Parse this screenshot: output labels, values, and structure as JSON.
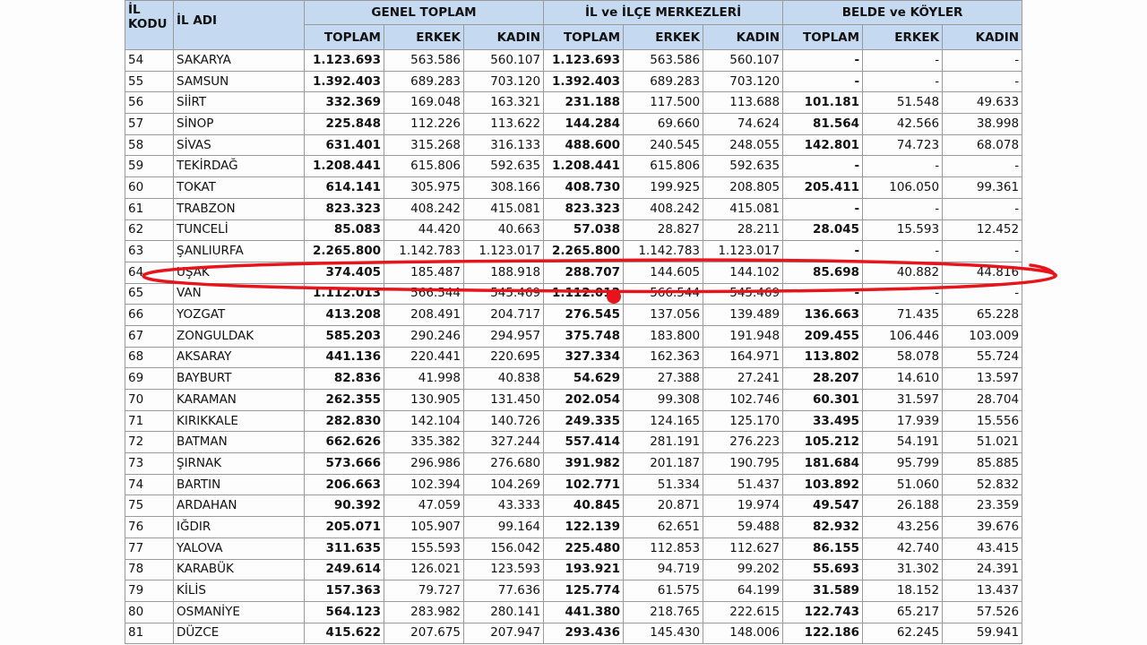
{
  "header": {
    "il_kodu": "İL KODU",
    "il_adi": "İL ADI",
    "groups": [
      "GENEL TOPLAM",
      "İL ve İLÇE MERKEZLERİ",
      "BELDE ve KÖYLER"
    ],
    "subcols": [
      "TOPLAM",
      "ERKEK",
      "KADIN",
      "TOPLAM",
      "ERKEK",
      "KADIN",
      "TOPLAM",
      "ERKEK",
      "KADIN"
    ]
  },
  "rows": [
    [
      "54",
      "SAKARYA",
      "1.123.693",
      "563.586",
      "560.107",
      "1.123.693",
      "563.586",
      "560.107",
      "-",
      "-",
      "-"
    ],
    [
      "55",
      "SAMSUN",
      "1.392.403",
      "689.283",
      "703.120",
      "1.392.403",
      "689.283",
      "703.120",
      "-",
      "-",
      "-"
    ],
    [
      "56",
      "SİİRT",
      "332.369",
      "169.048",
      "163.321",
      "231.188",
      "117.500",
      "113.688",
      "101.181",
      "51.548",
      "49.633"
    ],
    [
      "57",
      "SİNOP",
      "225.848",
      "112.226",
      "113.622",
      "144.284",
      "69.660",
      "74.624",
      "81.564",
      "42.566",
      "38.998"
    ],
    [
      "58",
      "SİVAS",
      "631.401",
      "315.268",
      "316.133",
      "488.600",
      "240.545",
      "248.055",
      "142.801",
      "74.723",
      "68.078"
    ],
    [
      "59",
      "TEKİRDAĞ",
      "1.208.441",
      "615.806",
      "592.635",
      "1.208.441",
      "615.806",
      "592.635",
      "-",
      "-",
      "-"
    ],
    [
      "60",
      "TOKAT",
      "614.141",
      "305.975",
      "308.166",
      "408.730",
      "199.925",
      "208.805",
      "205.411",
      "106.050",
      "99.361"
    ],
    [
      "61",
      "TRABZON",
      "823.323",
      "408.242",
      "415.081",
      "823.323",
      "408.242",
      "415.081",
      "-",
      "-",
      "-"
    ],
    [
      "62",
      "TUNCELİ",
      "85.083",
      "44.420",
      "40.663",
      "57.038",
      "28.827",
      "28.211",
      "28.045",
      "15.593",
      "12.452"
    ],
    [
      "63",
      "ŞANLIURFA",
      "2.265.800",
      "1.142.783",
      "1.123.017",
      "2.265.800",
      "1.142.783",
      "1.123.017",
      "-",
      "-",
      "-"
    ],
    [
      "64",
      "UŞAK",
      "374.405",
      "185.487",
      "188.918",
      "288.707",
      "144.605",
      "144.102",
      "85.698",
      "40.882",
      "44.816"
    ],
    [
      "65",
      "VAN",
      "1.112.013",
      "566.544",
      "545.469",
      "1.112.013",
      "566.544",
      "545.469",
      "-",
      "-",
      "-"
    ],
    [
      "66",
      "YOZGAT",
      "413.208",
      "208.491",
      "204.717",
      "276.545",
      "137.056",
      "139.489",
      "136.663",
      "71.435",
      "65.228"
    ],
    [
      "67",
      "ZONGULDAK",
      "585.203",
      "290.246",
      "294.957",
      "375.748",
      "183.800",
      "191.948",
      "209.455",
      "106.446",
      "103.009"
    ],
    [
      "68",
      "AKSARAY",
      "441.136",
      "220.441",
      "220.695",
      "327.334",
      "162.363",
      "164.971",
      "113.802",
      "58.078",
      "55.724"
    ],
    [
      "69",
      "BAYBURT",
      "82.836",
      "41.998",
      "40.838",
      "54.629",
      "27.388",
      "27.241",
      "28.207",
      "14.610",
      "13.597"
    ],
    [
      "70",
      "KARAMAN",
      "262.355",
      "130.905",
      "131.450",
      "202.054",
      "99.308",
      "102.746",
      "60.301",
      "31.597",
      "28.704"
    ],
    [
      "71",
      "KIRIKKALE",
      "282.830",
      "142.104",
      "140.726",
      "249.335",
      "124.165",
      "125.170",
      "33.495",
      "17.939",
      "15.556"
    ],
    [
      "72",
      "BATMAN",
      "662.626",
      "335.382",
      "327.244",
      "557.414",
      "281.191",
      "276.223",
      "105.212",
      "54.191",
      "51.021"
    ],
    [
      "73",
      "ŞIRNAK",
      "573.666",
      "296.986",
      "276.680",
      "391.982",
      "201.187",
      "190.795",
      "181.684",
      "95.799",
      "85.885"
    ],
    [
      "74",
      "BARTIN",
      "206.663",
      "102.394",
      "104.269",
      "102.771",
      "51.334",
      "51.437",
      "103.892",
      "51.060",
      "52.832"
    ],
    [
      "75",
      "ARDAHAN",
      "90.392",
      "47.059",
      "43.333",
      "40.845",
      "20.871",
      "19.974",
      "49.547",
      "26.188",
      "23.359"
    ],
    [
      "76",
      "IĞDIR",
      "205.071",
      "105.907",
      "99.164",
      "122.139",
      "62.651",
      "59.488",
      "82.932",
      "43.256",
      "39.676"
    ],
    [
      "77",
      "YALOVA",
      "311.635",
      "155.593",
      "156.042",
      "225.480",
      "112.853",
      "112.627",
      "86.155",
      "42.740",
      "43.415"
    ],
    [
      "78",
      "KARABÜK",
      "249.614",
      "126.021",
      "123.593",
      "193.921",
      "94.719",
      "99.202",
      "55.693",
      "31.302",
      "24.391"
    ],
    [
      "79",
      "KİLİS",
      "157.363",
      "79.727",
      "77.636",
      "125.774",
      "61.575",
      "64.199",
      "31.589",
      "18.152",
      "13.437"
    ],
    [
      "80",
      "OSMANİYE",
      "564.123",
      "283.982",
      "280.141",
      "441.380",
      "218.765",
      "222.615",
      "122.743",
      "65.217",
      "57.526"
    ],
    [
      "81",
      "DÜZCE",
      "415.622",
      "207.675",
      "207.947",
      "293.436",
      "145.430",
      "148.006",
      "122.186",
      "62.245",
      "59.941"
    ]
  ],
  "annotation_color": "#e8141c"
}
